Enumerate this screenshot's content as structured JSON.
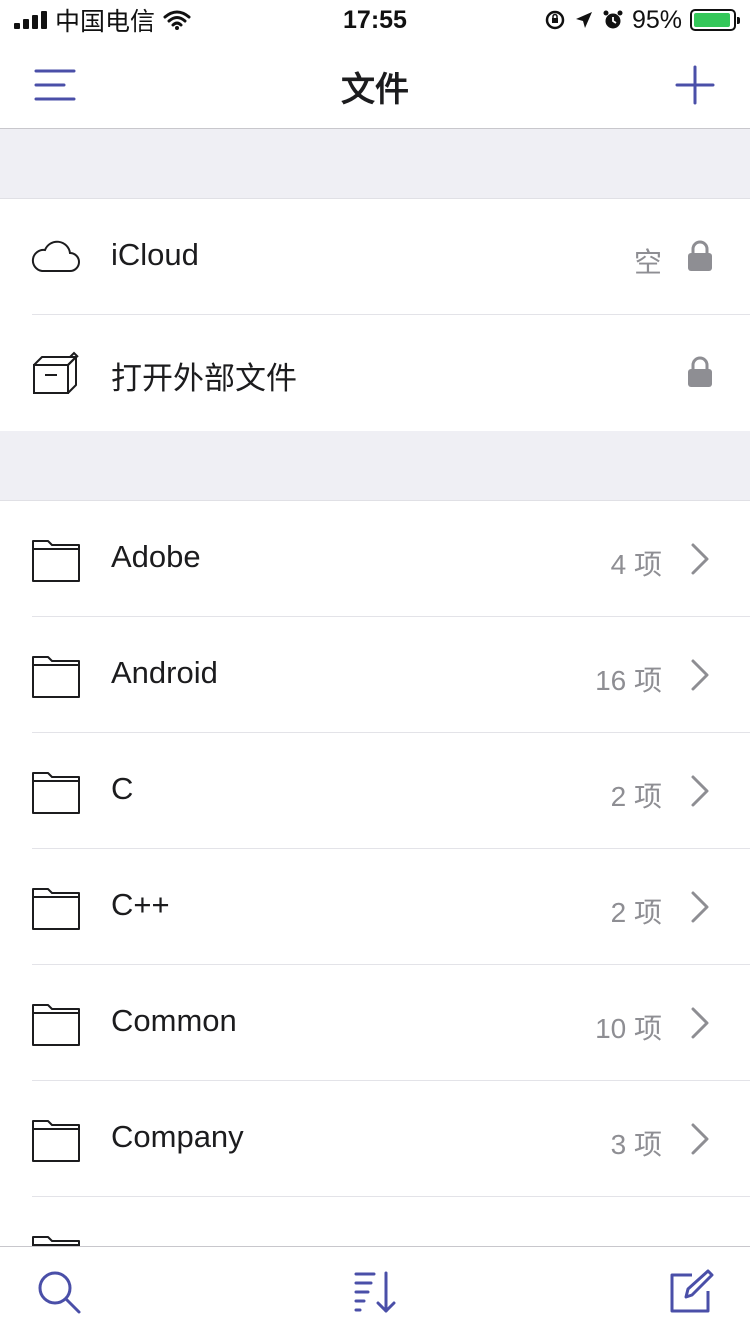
{
  "status": {
    "carrier": "中国电信",
    "time": "17:55",
    "battery": "95%",
    "battery_level": 0.95
  },
  "nav": {
    "title": "文件",
    "left_icon": "menu-icon",
    "right_icon": "plus-icon"
  },
  "locations": [
    {
      "label": "iCloud",
      "meta": "空",
      "icon": "cloud-icon",
      "locked": true
    },
    {
      "label": "打开外部文件",
      "meta": "",
      "icon": "box-icon",
      "locked": true
    }
  ],
  "folders": [
    {
      "label": "Adobe",
      "meta": "4 项"
    },
    {
      "label": "Android",
      "meta": "16 项"
    },
    {
      "label": "C",
      "meta": "2 项"
    },
    {
      "label": "C++",
      "meta": "2 项"
    },
    {
      "label": "Common",
      "meta": "10 项"
    },
    {
      "label": "Company",
      "meta": "3 项"
    }
  ],
  "tabbar": {
    "left_icon": "search-icon",
    "center_icon": "sort-icon",
    "right_icon": "compose-icon"
  },
  "colors": {
    "accent": "#4a4fa8",
    "secondary_text": "#8e8e93",
    "battery_green": "#34c759"
  }
}
